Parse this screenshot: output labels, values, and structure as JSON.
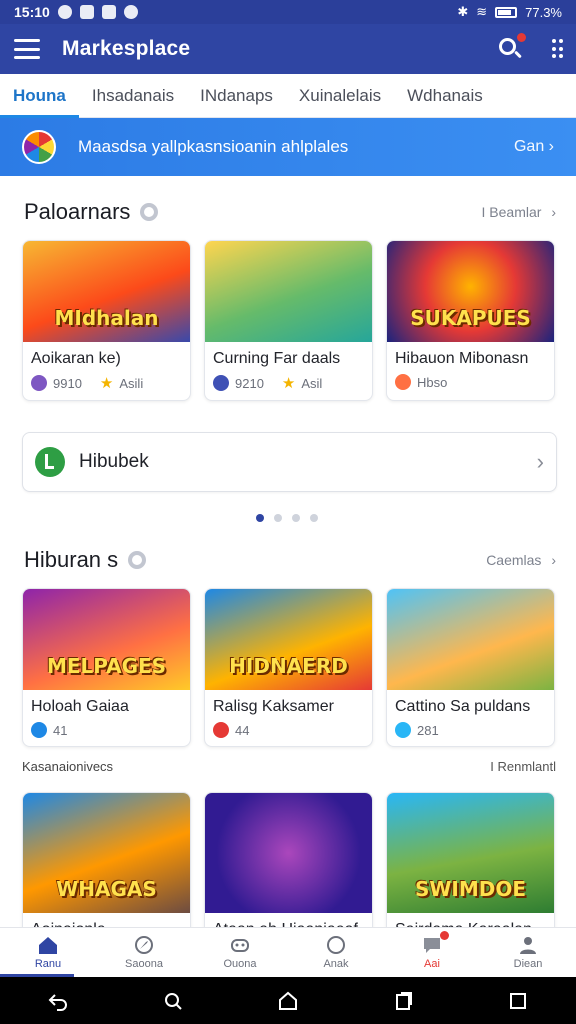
{
  "status": {
    "time": "15:10",
    "battery": "77.3%"
  },
  "appbar": {
    "title": "Markesplace"
  },
  "tabs": [
    {
      "label": "Houna"
    },
    {
      "label": "Ihsadanais"
    },
    {
      "label": "INdanaps"
    },
    {
      "label": "Xuinalelais"
    },
    {
      "label": "Wdhanais"
    }
  ],
  "banner": {
    "text": "Maasdsa yallpkasnsioanin ahlplales",
    "cta": "Gan",
    "cta_arrow": "›"
  },
  "section1": {
    "title": "Paloarnars",
    "see_all": "I Beamlar",
    "chevron": "›",
    "cards": [
      {
        "art": "MIdhalan",
        "title": "Aoikaran ke)",
        "count": "9910",
        "rating": "Asili",
        "icon_color": "#7e57c2",
        "bg": "linear-gradient(160deg,#f7b733,#fc4a1a 55%,#3949ab)"
      },
      {
        "art": "",
        "title": "Curning Far daals",
        "count": "9210",
        "rating": "Asil",
        "icon_color": "#3f51b5",
        "bg": "linear-gradient(160deg,#ffd54f,#66bb6a 55%,#26a69a)"
      },
      {
        "art": "SUKAPUES",
        "title": "Hibauon Mibonasn",
        "count": "Hbso",
        "rating": "",
        "icon_color": "#ff7043",
        "bg": "radial-gradient(circle at 50% 45%,#ffb300,#e53935 45%,#1a237e)"
      }
    ]
  },
  "promo": {
    "label": "Hibubek",
    "chevron": "›"
  },
  "section2": {
    "title": "Hiburan s",
    "see_all": "Caemlas",
    "chevron": "›",
    "cards": [
      {
        "art": "MELPAGES",
        "title": "Holoah Gaiaa",
        "count": "41",
        "icon_color": "#1e88e5",
        "bg": "linear-gradient(160deg,#8e24aa,#ff7043 60%,#ffca28)"
      },
      {
        "art": "HIDNAERD",
        "title": "Ralisg Kaksamer",
        "count": "44",
        "icon_color": "#e53935",
        "bg": "linear-gradient(160deg,#1e88e5,#ffb300 60%,#e53935)"
      },
      {
        "art": "",
        "title": "Cattino Sa puldans",
        "count": "281",
        "icon_color": "#29b6f6",
        "bg": "linear-gradient(160deg,#4fc3f7,#ffb74d 60%,#7cb342)"
      }
    ]
  },
  "section3": {
    "title": "Kasanaionivecs",
    "see_all": "I Renmlantl",
    "cards": [
      {
        "art": "WHAGAS",
        "title": "Aoinaionla",
        "bg": "linear-gradient(160deg,#1e88e5,#ff9800 55%,#6d4c41)"
      },
      {
        "art": "",
        "title": "Ataan ah Hiaaniaeaf",
        "bg": "radial-gradient(circle at 50% 50%,#ab47bc,#311b92 70%)"
      },
      {
        "art": "SWIMDOE",
        "title": "Sairdama Karaalan",
        "bg": "linear-gradient(170deg,#29b6f6,#7cb342 55%,#2e7d32)"
      }
    ]
  },
  "bottom_nav": [
    {
      "label": "Ranu"
    },
    {
      "label": "Saoona"
    },
    {
      "label": "Ouona"
    },
    {
      "label": "Anak"
    },
    {
      "label": "Aai"
    },
    {
      "label": "Diean"
    }
  ]
}
